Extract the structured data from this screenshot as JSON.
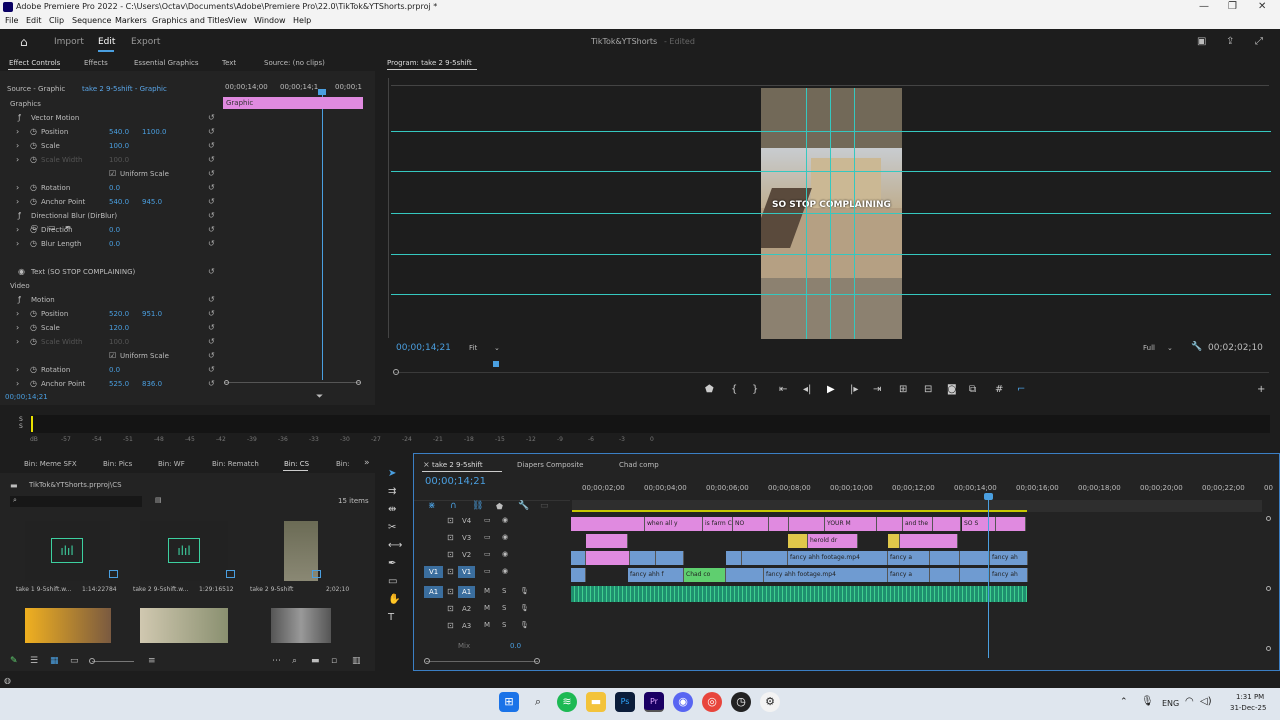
{
  "window": {
    "title": "Adobe Premiere Pro 2022 - C:\\Users\\Octav\\Documents\\Adobe\\Premiere Pro\\22.0\\TikTok&YTShorts.prproj *"
  },
  "menu": [
    "File",
    "Edit",
    "Clip",
    "Sequence",
    "Markers",
    "Graphics and Titles",
    "View",
    "Window",
    "Help"
  ],
  "header": {
    "tabs": [
      "Import",
      "Edit",
      "Export"
    ],
    "project": "TikTok&YTShorts",
    "status": "- Edited"
  },
  "effect_controls": {
    "tabs": [
      "Effect Controls",
      "Effects",
      "Essential Graphics",
      "Text",
      "Source: (no clips)"
    ],
    "source": "Source - Graphic",
    "clip": "take 2 9-5shift - Graphic",
    "ruler": [
      "00;00;14;00",
      "00;00;14;1",
      "00;00;1"
    ],
    "graphic_bar": "Graphic",
    "sections": {
      "graphics": "Graphics",
      "video": "Video"
    },
    "rows": [
      {
        "label": "Vector Motion",
        "v1": "",
        "v2": ""
      },
      {
        "label": "Position",
        "v1": "540.0",
        "v2": "1100.0"
      },
      {
        "label": "Scale",
        "v1": "100.0",
        "v2": ""
      },
      {
        "label": "Scale Width",
        "v1": "100.0",
        "v2": ""
      },
      {
        "label": "Uniform Scale",
        "v1": "",
        "v2": ""
      },
      {
        "label": "Rotation",
        "v1": "0.0",
        "v2": ""
      },
      {
        "label": "Anchor Point",
        "v1": "540.0",
        "v2": "945.0"
      },
      {
        "label": "Directional Blur (DirBlur)",
        "v1": "",
        "v2": ""
      },
      {
        "label": "Direction",
        "v1": "0.0",
        "v2": ""
      },
      {
        "label": "Blur Length",
        "v1": "0.0",
        "v2": ""
      },
      {
        "label": "Text (SO STOP COMPLAINING)",
        "v1": "",
        "v2": ""
      },
      {
        "label": "Motion",
        "v1": "",
        "v2": ""
      },
      {
        "label": "Position",
        "v1": "520.0",
        "v2": "951.0"
      },
      {
        "label": "Scale",
        "v1": "120.0",
        "v2": ""
      },
      {
        "label": "Scale Width",
        "v1": "100.0",
        "v2": ""
      },
      {
        "label": "Uniform Scale",
        "v1": "",
        "v2": ""
      },
      {
        "label": "Rotation",
        "v1": "0.0",
        "v2": ""
      },
      {
        "label": "Anchor Point",
        "v1": "525.0",
        "v2": "836.0"
      }
    ],
    "timecode": "00;00;14;21"
  },
  "program": {
    "title": "Program: take 2 9-5shift",
    "overlay_text": "SO STOP COMPLAINING",
    "timecode": "00;00;14;21",
    "fit": "Fit",
    "quality": "Full",
    "duration": "00;02;02;10"
  },
  "audio_meter": {
    "scale": [
      "dB",
      "-57",
      "-54",
      "-51",
      "-48",
      "-45",
      "-42",
      "-39",
      "-36",
      "-33",
      "-30",
      "-27",
      "-24",
      "-21",
      "-18",
      "-15",
      "-12",
      "-9",
      "-6",
      "-3",
      "0"
    ]
  },
  "project": {
    "bins": [
      "Bin: Meme SFX",
      "Bin: Pics",
      "Bin: WF",
      "Bin: Rematch",
      "Bin: CS",
      "Bin:"
    ],
    "path": "TikTok&YTShorts.prproj\\CS",
    "items_count": "15 items",
    "thumbs": [
      {
        "name": "take 1 9-5shift.w...",
        "dur": "1:14:22784"
      },
      {
        "name": "take 2 9-5shift.w...",
        "dur": "1:29:16512"
      },
      {
        "name": "take 2 9-5shift",
        "dur": "2;02;10"
      }
    ]
  },
  "timeline": {
    "tabs": [
      "take 2 9-5shift",
      "Diapers Composite",
      "Chad comp"
    ],
    "timecode": "00;00;14;21",
    "ruler": [
      "00;00;02;00",
      "00;00;04;00",
      "00;00;06;00",
      "00;00;08;00",
      "00;00;10;00",
      "00;00;12;00",
      "00;00;14;00",
      "00;00;16;00",
      "00;00;18;00",
      "00;00;20;00",
      "00;00;22;00",
      "00"
    ],
    "tracks": [
      "V4",
      "V3",
      "V2",
      "V1",
      "A1",
      "A2",
      "A3"
    ],
    "mix": "Mix",
    "mix_val": "0.0",
    "clips": {
      "v4": [
        "when all y",
        "is farm C",
        "NO",
        "YOUR M",
        "and the",
        "SO S"
      ],
      "v3": [
        "herold dr"
      ],
      "v2": [
        "fancy ahh footage.mp4",
        "fancy a",
        "fancy ah"
      ],
      "v1": [
        "fancy ahh f",
        "Chad co",
        "fancy ahh footage.mp4",
        "fancy a",
        "fancy ah"
      ]
    }
  },
  "taskbar": {
    "time": "1:31 PM",
    "date": "31-Dec-25",
    "lang": "ENG"
  }
}
